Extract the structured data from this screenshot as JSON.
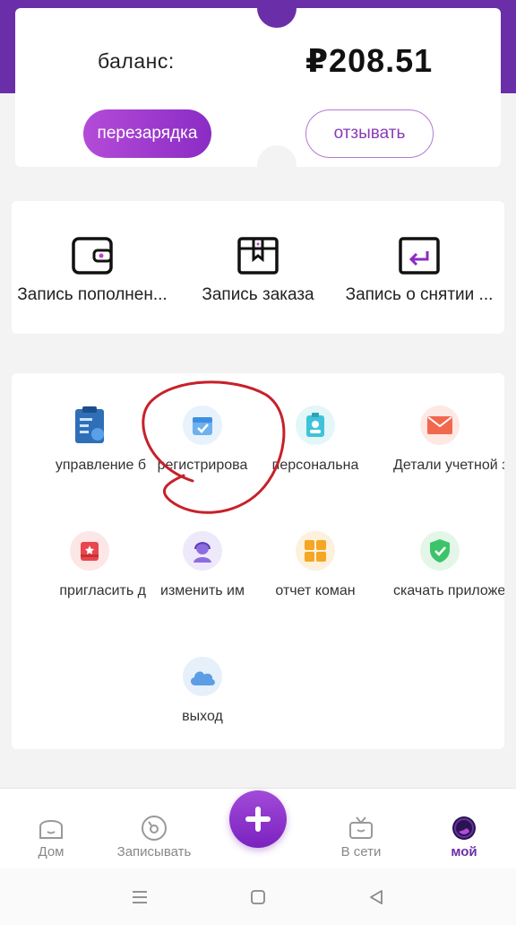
{
  "balance": {
    "label": "баланс:",
    "value": "₽208.51",
    "recharge_label": "перезарядка",
    "withdraw_label": "отзывать"
  },
  "records": [
    {
      "label": "Запись пополнен...",
      "icon": "wallet-icon"
    },
    {
      "label": "Запись заказа",
      "icon": "box-icon"
    },
    {
      "label": "Запись о снятии ...",
      "icon": "return-icon"
    }
  ],
  "menu": [
    {
      "label": "управление б",
      "icon": "clipboard-icon"
    },
    {
      "label": "регистрирова",
      "icon": "calendar-check-icon"
    },
    {
      "label": "персональна",
      "icon": "id-badge-icon"
    },
    {
      "label": "Детали учетной за",
      "icon": "mail-icon"
    },
    {
      "label": "пригласить д",
      "icon": "gift-icon"
    },
    {
      "label": "изменить им",
      "icon": "support-agent-icon"
    },
    {
      "label": "отчет коман",
      "icon": "grid-icon"
    },
    {
      "label": "скачать приложен",
      "icon": "shield-check-icon"
    },
    {
      "label": "выход",
      "icon": "cloud-icon"
    }
  ],
  "tabbar": {
    "items": [
      {
        "label": "Дом",
        "icon": "home-icon"
      },
      {
        "label": "Записывать",
        "icon": "record-icon"
      },
      {
        "label": "В сети",
        "icon": "online-icon"
      },
      {
        "label": "мой",
        "icon": "profile-icon"
      }
    ],
    "active": "мой",
    "fab_icon": "plus-icon"
  },
  "colors": {
    "brand": "#6a2fa8",
    "accent": "#9b3fd0",
    "annotation": "#c8202a"
  }
}
